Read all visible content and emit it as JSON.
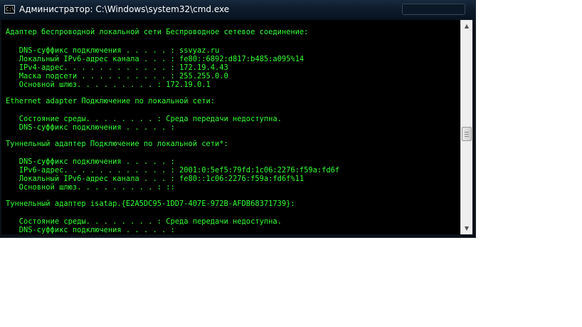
{
  "window": {
    "title": "Администратор: C:\\Windows\\system32\\cmd.exe",
    "icon_label": "C:\\",
    "icon": "cmd-icon"
  },
  "console": {
    "lines": [
      "Адаптер беспроводной локальной сети Беспроводное сетевое соединение:",
      "   DNS-суффикс подключения . . . . . : ssvyaz.ru",
      "   Локальный IPv6-адрес канала . . . : fe80::6892:d817:b485:a095%14",
      "   IPv4-адрес. . . . . . . . . . . . : 172.19.4.43",
      "   Маска подсети . . . . . . . . . . : 255.255.0.0",
      "   Основной шлюз. . . . . . . . . : 172.19.0.1",
      "Ethernet adapter Подключение по локальной сети:",
      "   Состояние среды. . . . . . . . : Среда передачи недоступна.",
      "   DNS-суффикс подключения . . . . . :",
      "Туннельный адаптер Подключение по локальной сети*:",
      "   DNS-суффикс подключения . . . . . :",
      "   IPv6-адрес. . . . . . . . . . . . : 2001:0:5ef5:79fd:1c06:2276:f59a:fd6f",
      "   Локальный IPv6-адрес канала . . . : fe80::1c06:2276:f59a:fd6f%11",
      "   Основной шлюз. . . . . . . . . : ::",
      "Туннельный адаптер isatap.{E2A5DC95-1DD7-407E-972B-AFDB68371739}:",
      "   Состояние среды. . . . . . . . : Среда передачи недоступна.",
      "   DNS-суффикс подключения . . . . . :"
    ]
  },
  "scrollbar": {
    "up_icon": "arrow-up-icon",
    "down_icon": "arrow-down-icon"
  },
  "colors": {
    "console_text": "#32ff32",
    "console_bg": "#000000",
    "titlebar": "#0d1b2b"
  }
}
